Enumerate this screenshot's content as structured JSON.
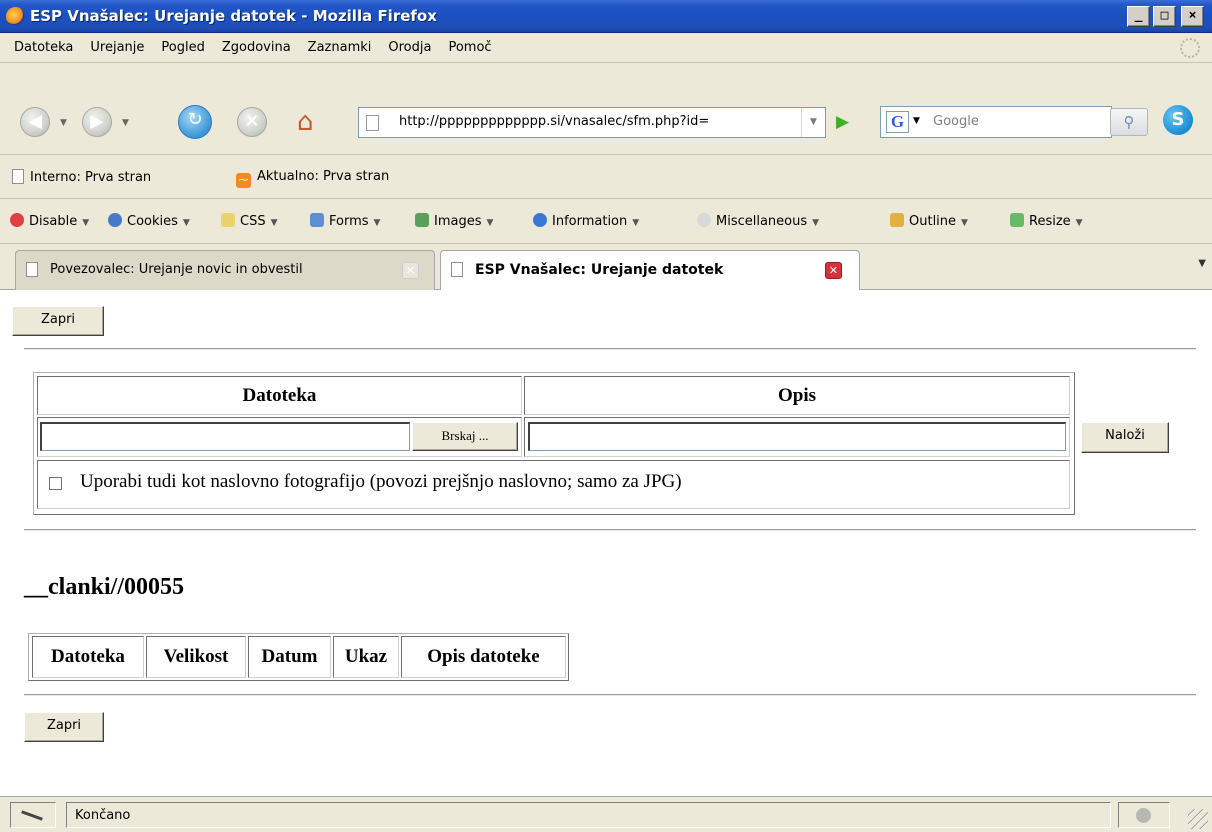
{
  "window": {
    "title": "ESP Vnašalec: Urejanje datotek - Mozilla Firefox",
    "controls": [
      "_",
      "□",
      "×"
    ]
  },
  "menu": [
    "Datoteka",
    "Urejanje",
    "Pogled",
    "Zgodovina",
    "Zaznamki",
    "Orodja",
    "Pomoč"
  ],
  "navigation": {
    "url": "http://ppppppppppppp.si/vnasalec/sfm.php?id=",
    "search_placeholder": "Google",
    "search_engine_letter": "G"
  },
  "bookmarks": [
    "Interno: Prva stran",
    "Aktualno: Prva stran"
  ],
  "devtoolbar": [
    "Disable",
    "Cookies",
    "CSS",
    "Forms",
    "Images",
    "Information",
    "Miscellaneous",
    "Outline",
    "Resize"
  ],
  "tabs": [
    {
      "label": "Povezovalec: Urejanje novic in obvestil",
      "active": false
    },
    {
      "label": "ESP Vnašalec: Urejanje datotek",
      "active": true
    }
  ],
  "content": {
    "close_label": "Zapri",
    "upload": {
      "col_file": "Datoteka",
      "col_desc": "Opis",
      "browse_label": "Brskaj ...",
      "upload_label": "Naloži",
      "checkbox_label": "Uporabi tudi kot naslovno fotografijo (povozi prejšnjo naslovno; samo za JPG)",
      "checkbox_checked": false
    },
    "folder_heading": "__clanki//00055",
    "files_columns": [
      "Datoteka",
      "Velikost",
      "Datum",
      "Ukaz",
      "Opis datoteke"
    ]
  },
  "status": {
    "text": "Končano"
  },
  "colors": {
    "titlebar": "#1b50c2",
    "chrome": "#ece9d8",
    "close_tab": "#d7323c"
  }
}
